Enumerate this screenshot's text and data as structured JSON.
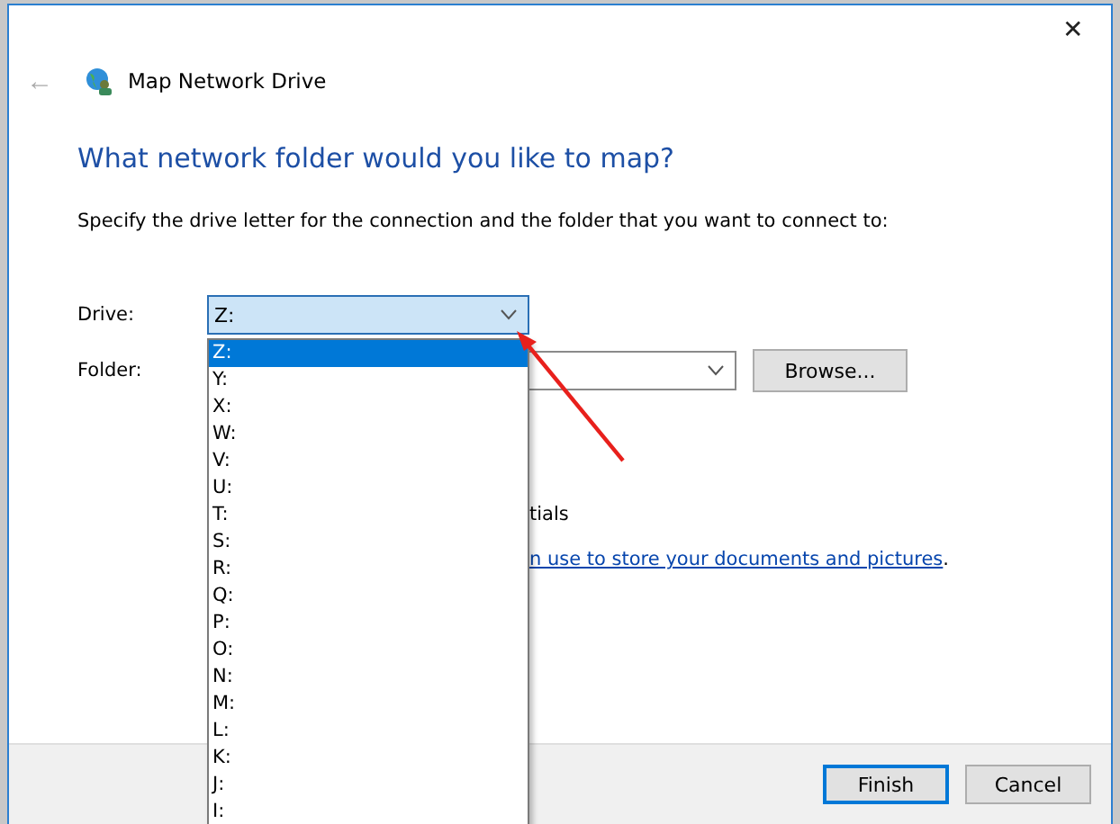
{
  "window": {
    "title": "Map Network Drive",
    "close": "✕",
    "back": "←"
  },
  "heading": "What network folder would you like to map?",
  "instruction": "Specify the drive letter for the connection and the folder that you want to connect to:",
  "drive": {
    "label": "Drive:",
    "value": "Z:",
    "open": true
  },
  "folder": {
    "label": "Folder:"
  },
  "browse": "Browse...",
  "drive_options": [
    {
      "label": "Z:",
      "selected": true
    },
    {
      "label": "Y:",
      "selected": false
    },
    {
      "label": "X:",
      "selected": false
    },
    {
      "label": "W:",
      "selected": false
    },
    {
      "label": "V:",
      "selected": false
    },
    {
      "label": "U:",
      "selected": false
    },
    {
      "label": "T:",
      "selected": false
    },
    {
      "label": "S:",
      "selected": false
    },
    {
      "label": "R:",
      "selected": false
    },
    {
      "label": "Q:",
      "selected": false
    },
    {
      "label": "P:",
      "selected": false
    },
    {
      "label": "O:",
      "selected": false
    },
    {
      "label": "N:",
      "selected": false
    },
    {
      "label": "M:",
      "selected": false
    },
    {
      "label": "L:",
      "selected": false
    },
    {
      "label": "K:",
      "selected": false
    },
    {
      "label": "J:",
      "selected": false
    },
    {
      "label": "I:",
      "selected": false
    }
  ],
  "credentials_text": "tials",
  "link": {
    "text": "n use to store your documents and pictures",
    "after": "."
  },
  "buttons": [
    {
      "label": "Finish",
      "default": true
    },
    {
      "label": "Cancel",
      "default": false
    }
  ]
}
